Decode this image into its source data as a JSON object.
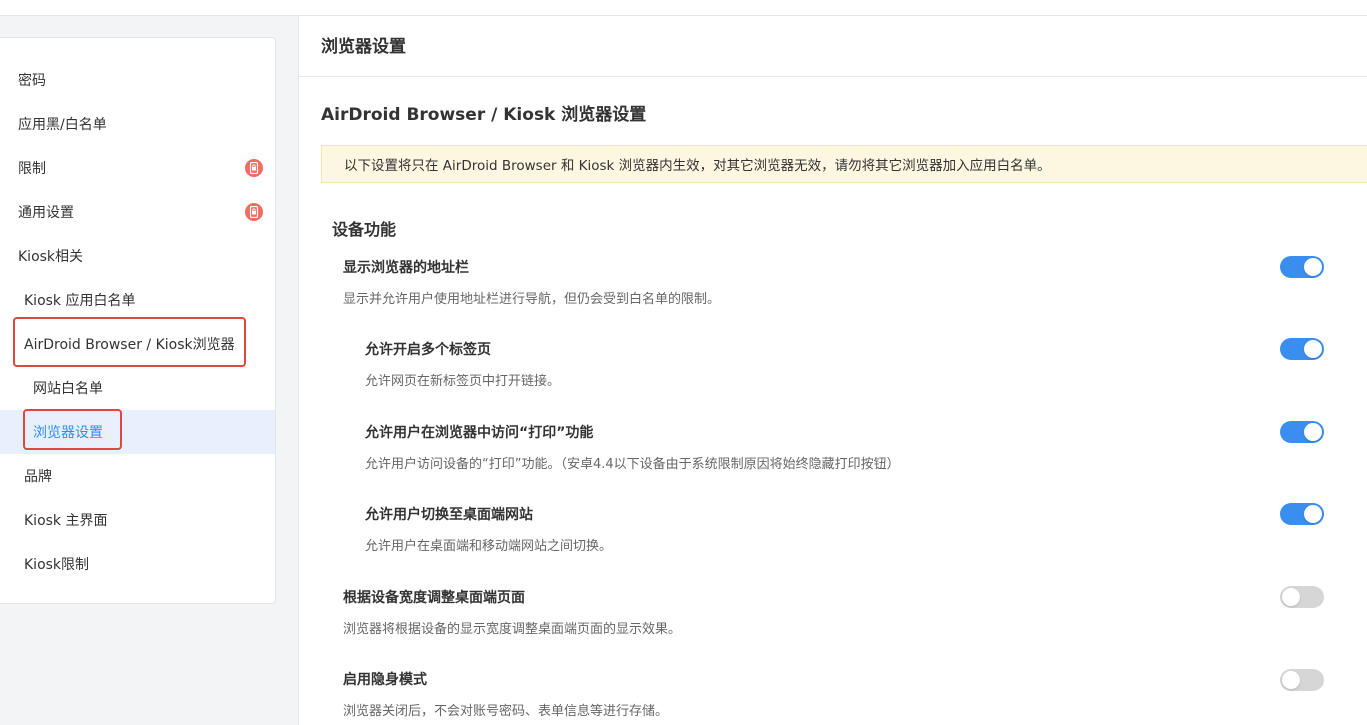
{
  "sidebar": {
    "items": [
      {
        "label": "密码",
        "badge": false
      },
      {
        "label": "应用黑/白名单",
        "badge": false
      },
      {
        "label": "限制",
        "badge": true
      },
      {
        "label": "通用设置",
        "badge": true
      },
      {
        "label": "Kiosk相关",
        "badge": false
      },
      {
        "label": "Kiosk 应用白名单",
        "badge": false
      },
      {
        "label": "AirDroid Browser / Kiosk浏览器",
        "badge": false
      },
      {
        "label": "网站白名单",
        "badge": false
      },
      {
        "label": "浏览器设置",
        "badge": false,
        "active": true
      },
      {
        "label": "品牌",
        "badge": false
      },
      {
        "label": "Kiosk 主界面",
        "badge": false
      },
      {
        "label": "Kiosk限制",
        "badge": false
      }
    ],
    "badge_icon": "lock-phone-icon"
  },
  "main": {
    "page_title": "浏览器设置",
    "section_title": "AirDroid Browser / Kiosk 浏览器设置",
    "notice": "以下设置将只在 AirDroid Browser 和 Kiosk 浏览器内生效，对其它浏览器无效，请勿将其它浏览器加入应用白名单。",
    "group_title": "设备功能",
    "settings": [
      {
        "title": "显示浏览器的地址栏",
        "desc": "显示并允许用户使用地址栏进行导航，但仍会受到白名单的限制。",
        "enabled": true
      },
      {
        "title": "允许开启多个标签页",
        "desc": "允许网页在新标签页中打开链接。",
        "enabled": true
      },
      {
        "title": "允许用户在浏览器中访问“打印”功能",
        "desc": "允许用户访问设备的“打印”功能。（安卓4.4以下设备由于系统限制原因将始终隐藏打印按钮）",
        "enabled": true
      },
      {
        "title": "允许用户切换至桌面端网站",
        "desc": "允许用户在桌面端和移动端网站之间切换。",
        "enabled": true
      },
      {
        "title": "根据设备宽度调整桌面端页面",
        "desc": "浏览器将根据设备的显示宽度调整桌面端页面的显示效果。",
        "enabled": false
      },
      {
        "title": "启用隐身模式",
        "desc": "浏览器关闭后，不会对账号密码、表单信息等进行存储。",
        "enabled": false
      }
    ]
  },
  "colors": {
    "accent": "#3a8ef0",
    "active_text": "#2f8ef5",
    "active_bg": "#e8f0fd",
    "highlight_border": "#e0483a",
    "badge": "#f26b62",
    "notice_bg": "#fdf7e2"
  }
}
